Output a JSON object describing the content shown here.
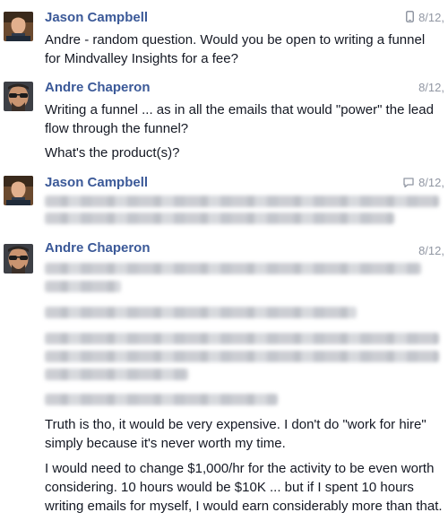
{
  "colors": {
    "name": "#3b5998",
    "text": "#141823",
    "meta": "#9197a3"
  },
  "messages": [
    {
      "author": "Jason Campbell",
      "time": "8/12,",
      "status_icon": "phone-icon",
      "text": [
        "Andre - random question.  Would you be open to writing a funnel for Mindvalley Insights for a fee?"
      ]
    },
    {
      "author": "Andre Chaperon",
      "time": "8/12,",
      "text": [
        "Writing a funnel ... as in all the emails that would \"power\" the lead flow through the funnel?",
        "What's the product(s)?"
      ]
    },
    {
      "author": "Jason Campbell",
      "time": "8/12,",
      "status_icon": "chat-icon",
      "text": []
    },
    {
      "author": "Andre Chaperon",
      "time": "8/12,",
      "text": [
        "Truth is tho, it would be very expensive. I don't do \"work for hire\" simply because it's never worth my time.",
        "I would need to change $1,000/hr for the activity to be even worth considering. 10 hours would be $10K ... but if I spent 10 hours writing emails for myself, I would earn considerably more than that."
      ]
    }
  ]
}
